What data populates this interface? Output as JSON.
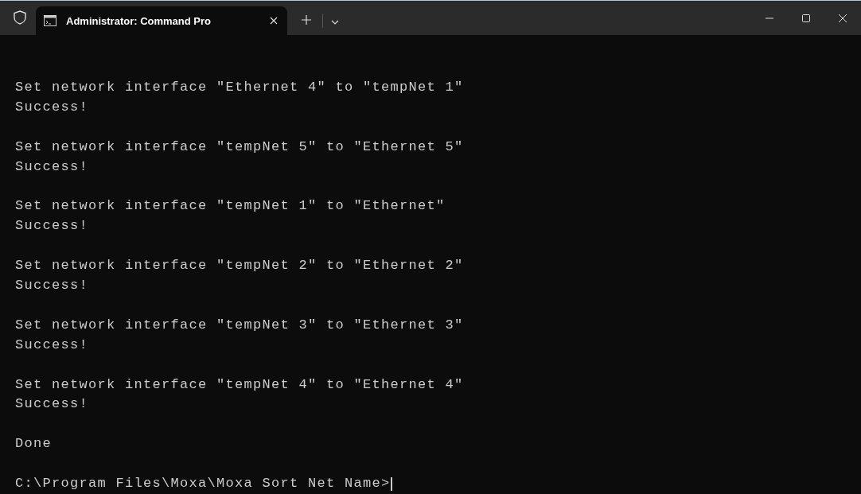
{
  "tab": {
    "title": "Administrator: Command Pro",
    "selected": true
  },
  "terminal": {
    "blocks": [
      [
        "Set network interface \"Ethernet 4\" to \"tempNet 1\"",
        "Success!"
      ],
      [
        "Set network interface \"tempNet 5\" to \"Ethernet 5\"",
        "Success!"
      ],
      [
        "Set network interface \"tempNet 1\" to \"Ethernet\"",
        "Success!"
      ],
      [
        "Set network interface \"tempNet 2\" to \"Ethernet 2\"",
        "Success!"
      ],
      [
        "Set network interface \"tempNet 3\" to \"Ethernet 3\"",
        "Success!"
      ],
      [
        "Set network interface \"tempNet 4\" to \"Ethernet 4\"",
        "Success!"
      ],
      [
        "Done"
      ]
    ],
    "prompt": "C:\\Program Files\\Moxa\\Moxa Sort Net Name>"
  }
}
